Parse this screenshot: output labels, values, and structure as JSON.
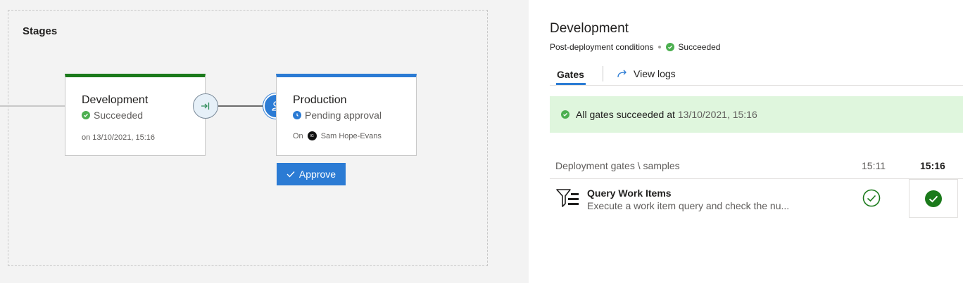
{
  "canvas": {
    "section_title": "Stages",
    "stages": [
      {
        "name": "Development",
        "status": "Succeeded",
        "date": "on 13/10/2021, 15:16",
        "accent": "#1b7a1b"
      },
      {
        "name": "Production",
        "status": "Pending approval",
        "on_label": "On",
        "approver_initials": "IG",
        "approver": "Sam Hope-Evans",
        "accent": "#2b7bd4"
      }
    ],
    "approve_label": "Approve"
  },
  "panel": {
    "title": "Development",
    "subtitle": "Post-deployment conditions",
    "status": "Succeeded",
    "tabs": {
      "gates": "Gates",
      "logs": "View logs"
    },
    "banner": {
      "text": "All gates succeeded at",
      "time": "13/10/2021, 15:16"
    },
    "grid": {
      "header": "Deployment gates \\ samples",
      "sample_times": [
        "15:11",
        "15:16"
      ],
      "rows": [
        {
          "name": "Query Work Items",
          "description": "Execute a work item query and check the nu..."
        }
      ]
    }
  },
  "colors": {
    "success": "#4caf50",
    "success_dark": "#1b7a1b",
    "accent": "#2b7bd4",
    "banner_bg": "#dff6dd"
  }
}
